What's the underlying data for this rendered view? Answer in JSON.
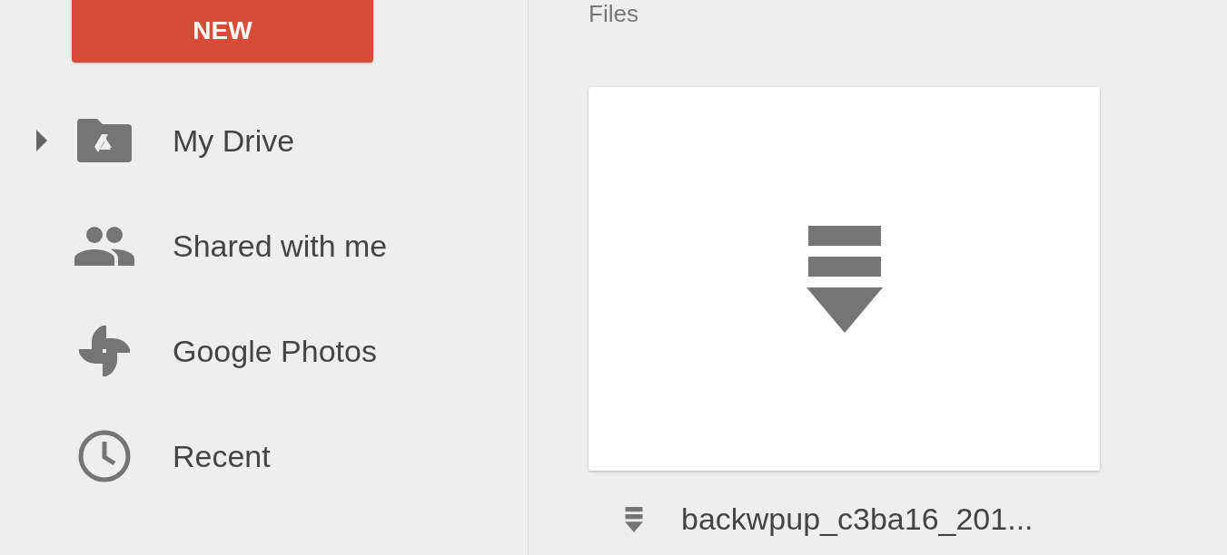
{
  "sidebar": {
    "new_button": "NEW",
    "items": [
      {
        "label": "My Drive",
        "kind": "drive",
        "expandable": true
      },
      {
        "label": "Shared with me",
        "kind": "people",
        "expandable": false
      },
      {
        "label": "Google Photos",
        "kind": "photos",
        "expandable": false
      },
      {
        "label": "Recent",
        "kind": "clock",
        "expandable": false
      }
    ]
  },
  "main": {
    "section_title": "Files",
    "files": [
      {
        "name": "backwpup_c3ba16_201..."
      }
    ]
  }
}
